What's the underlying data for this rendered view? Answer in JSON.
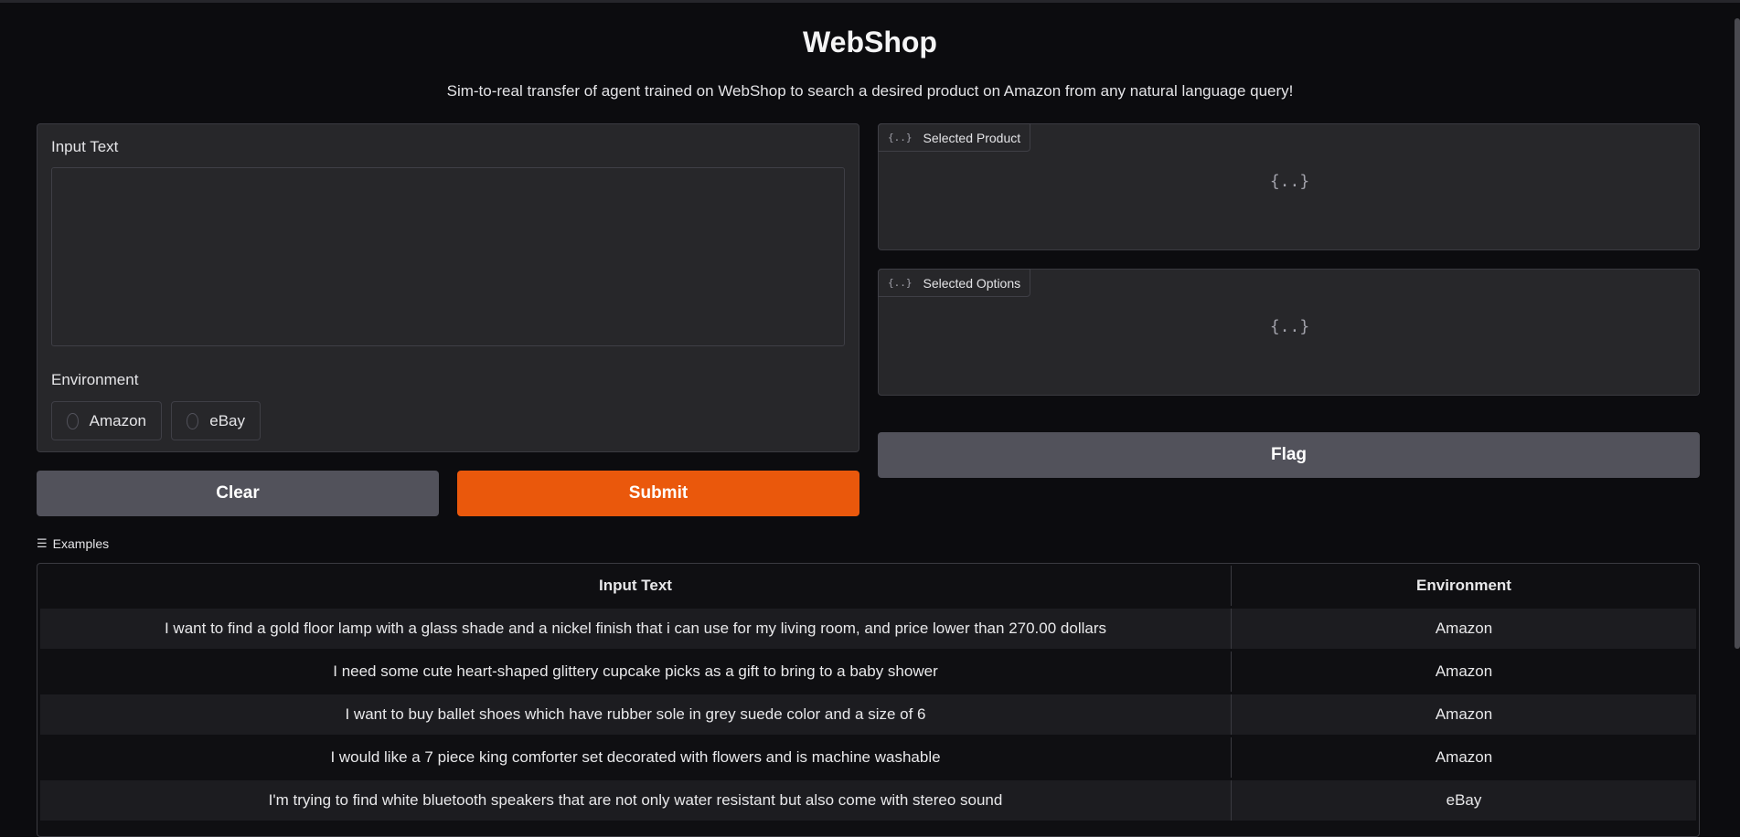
{
  "header": {
    "title": "WebShop",
    "subtitle": "Sim-to-real transfer of agent trained on WebShop to search a desired product on Amazon from any natural language query!"
  },
  "input_panel": {
    "input_label": "Input Text",
    "input_value": "",
    "environment_label": "Environment",
    "environment_options": [
      "Amazon",
      "eBay"
    ],
    "selected_environment": ""
  },
  "buttons": {
    "clear": "Clear",
    "submit": "Submit",
    "flag": "Flag"
  },
  "outputs": {
    "selected_product": {
      "label": "Selected Product",
      "value": "{..}"
    },
    "selected_options": {
      "label": "Selected Options",
      "value": "{..}"
    },
    "json_icon": "{..}"
  },
  "examples": {
    "heading": "Examples",
    "columns": [
      "Input Text",
      "Environment"
    ],
    "rows": [
      [
        "I want to find a gold floor lamp with a glass shade and a nickel finish that i can use for my living room, and price lower than 270.00 dollars",
        "Amazon"
      ],
      [
        "I need some cute heart-shaped glittery cupcake picks as a gift to bring to a baby shower",
        "Amazon"
      ],
      [
        "I want to buy ballet shoes which have rubber sole in grey suede color and a size of 6",
        "Amazon"
      ],
      [
        "I would like a 7 piece king comforter set decorated with flowers and is machine washable",
        "Amazon"
      ],
      [
        "I'm trying to find white bluetooth speakers that are not only water resistant but also come with stereo sound",
        "eBay"
      ]
    ]
  },
  "colors": {
    "background": "#0c0c0f",
    "panel": "#27272a",
    "accent_submit": "#ea580c",
    "secondary_button": "#52525b"
  },
  "icons": {
    "json": "json-icon",
    "examples": "list-icon",
    "radio": "radio-circle-icon"
  }
}
